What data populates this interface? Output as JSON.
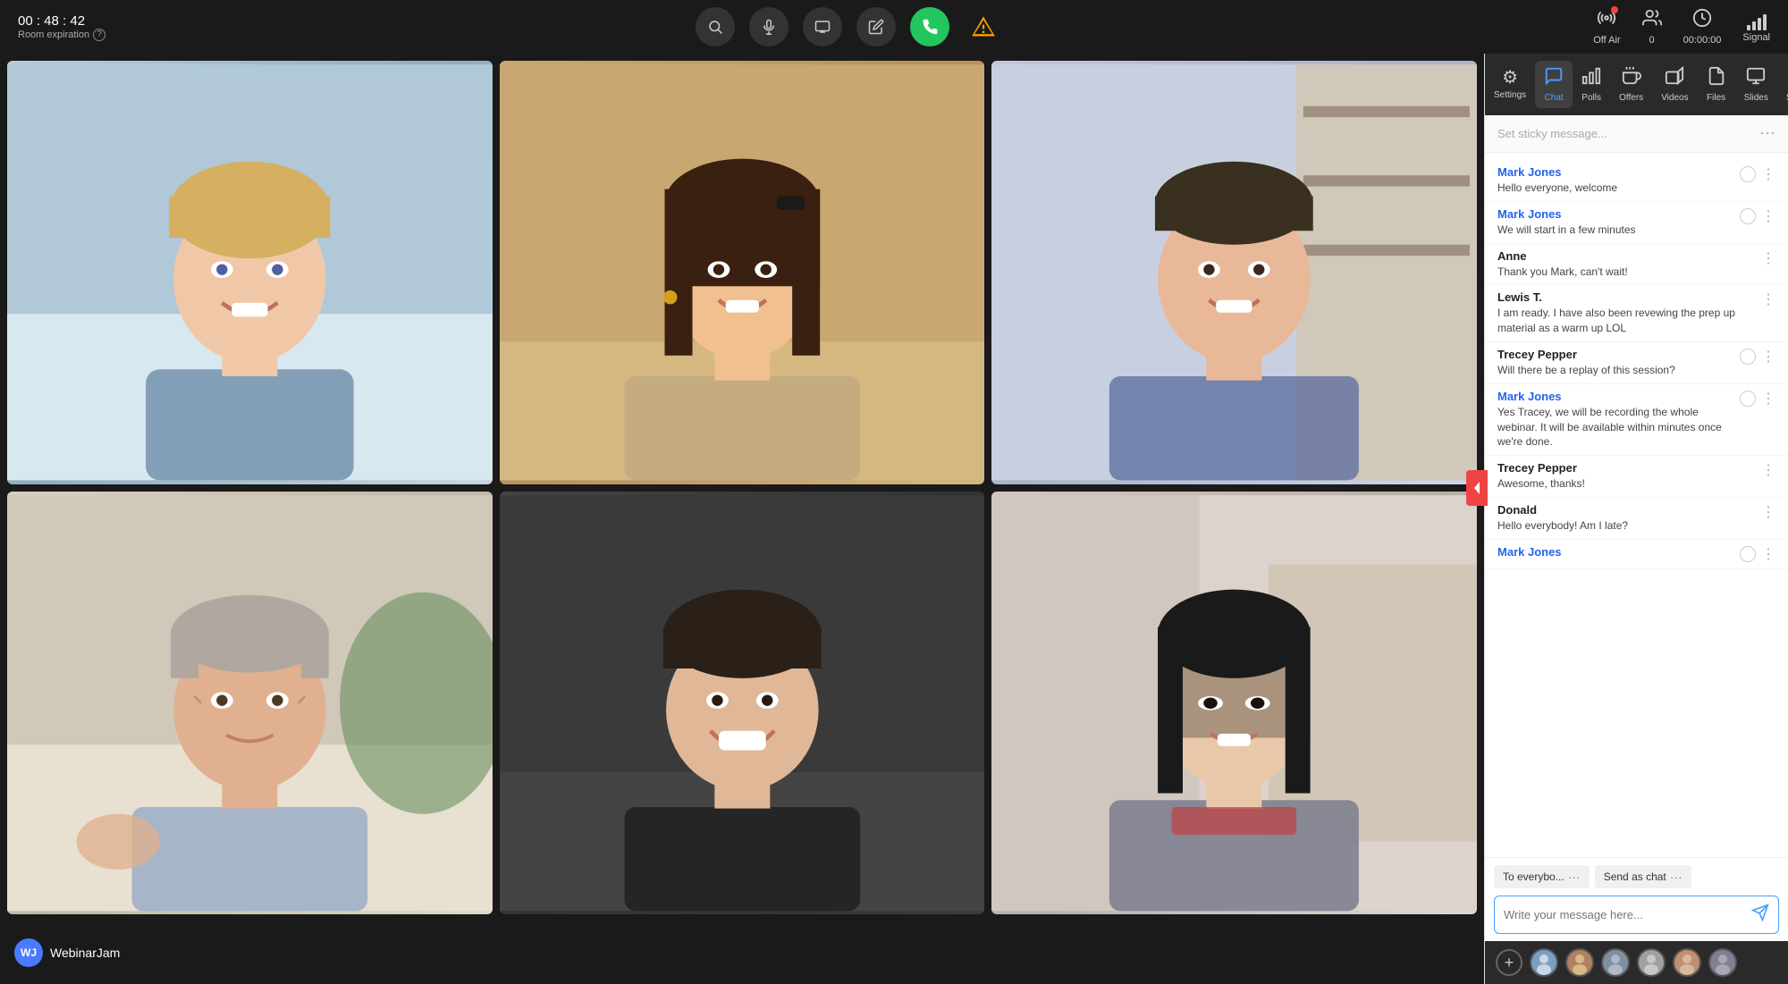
{
  "header": {
    "timer": "00 : 48 : 42",
    "expiry_label": "Room expiration",
    "expiry_help": "?",
    "controls": [
      {
        "id": "search",
        "icon": "🔍",
        "label": "search"
      },
      {
        "id": "mic",
        "icon": "🎙",
        "label": "mic"
      },
      {
        "id": "screen",
        "icon": "🖥",
        "label": "screen"
      },
      {
        "id": "pencil",
        "icon": "✏",
        "label": "pencil"
      },
      {
        "id": "phone",
        "icon": "📞",
        "label": "phone",
        "color": "green"
      },
      {
        "id": "warning",
        "icon": "⚠",
        "label": "warning"
      }
    ],
    "stats": {
      "off_air": "Off Air",
      "viewers": "0",
      "duration": "00:00:00",
      "signal": "Signal"
    }
  },
  "video_grid": {
    "cells": [
      {
        "id": "cell1",
        "label": "Person 1"
      },
      {
        "id": "cell2",
        "label": "Person 2"
      },
      {
        "id": "cell3",
        "label": "Person 3"
      },
      {
        "id": "cell4",
        "label": "Person 4"
      },
      {
        "id": "cell5",
        "label": "Person 5"
      },
      {
        "id": "cell6",
        "label": "Person 6"
      }
    ]
  },
  "bottom_bar": {
    "logo_initials": "WJ",
    "app_name": "WebinarJam"
  },
  "right_panel": {
    "nav_items": [
      {
        "id": "settings",
        "icon": "⚙",
        "label": "Settings"
      },
      {
        "id": "chat",
        "icon": "💬",
        "label": "Chat",
        "active": true
      },
      {
        "id": "polls",
        "icon": "📊",
        "label": "Polls"
      },
      {
        "id": "offers",
        "icon": "📣",
        "label": "Offers"
      },
      {
        "id": "videos",
        "icon": "▶",
        "label": "Videos"
      },
      {
        "id": "files",
        "icon": "📄",
        "label": "Files"
      },
      {
        "id": "slides",
        "icon": "🖼",
        "label": "Slides"
      },
      {
        "id": "speak",
        "icon": "✋",
        "label": "Speak"
      }
    ],
    "sticky_placeholder": "Set sticky message...",
    "messages": [
      {
        "id": "msg1",
        "sender": "Mark Jones",
        "sender_type": "blue",
        "text": "Hello everyone, welcome",
        "has_circle": true
      },
      {
        "id": "msg2",
        "sender": "Mark Jones",
        "sender_type": "blue",
        "text": "We will start in a few minutes",
        "has_circle": true
      },
      {
        "id": "msg3",
        "sender": "Anne",
        "sender_type": "dark",
        "text": "Thank you Mark, can't wait!",
        "has_circle": false
      },
      {
        "id": "msg4",
        "sender": "Lewis T.",
        "sender_type": "dark",
        "text": "I am ready. I have also been revewing the prep up material as a warm up LOL",
        "has_circle": false
      },
      {
        "id": "msg5",
        "sender": "Trecey Pepper",
        "sender_type": "dark",
        "text": "Will there be a replay of this session?",
        "has_circle": true
      },
      {
        "id": "msg6",
        "sender": "Mark Jones",
        "sender_type": "blue",
        "text": "Yes Tracey, we will be recording the whole webinar. It will be available within minutes once we're done.",
        "has_circle": true
      },
      {
        "id": "msg7",
        "sender": "Trecey Pepper",
        "sender_type": "dark",
        "text": "Awesome, thanks!",
        "has_circle": false
      },
      {
        "id": "msg8",
        "sender": "Donald",
        "sender_type": "dark",
        "text": "Hello everybody! Am I late?",
        "has_circle": false
      },
      {
        "id": "msg9",
        "sender": "Mark Jones",
        "sender_type": "blue",
        "text": "",
        "has_circle": true
      }
    ],
    "input": {
      "recipient_label": "To everybo...",
      "recipient_more": "···",
      "send_as_label": "Send as chat",
      "send_as_more": "···",
      "placeholder": "Write your message here..."
    },
    "attendees": [
      "av-1",
      "av-2",
      "av-3",
      "av-4",
      "av-5",
      "av-6"
    ]
  }
}
